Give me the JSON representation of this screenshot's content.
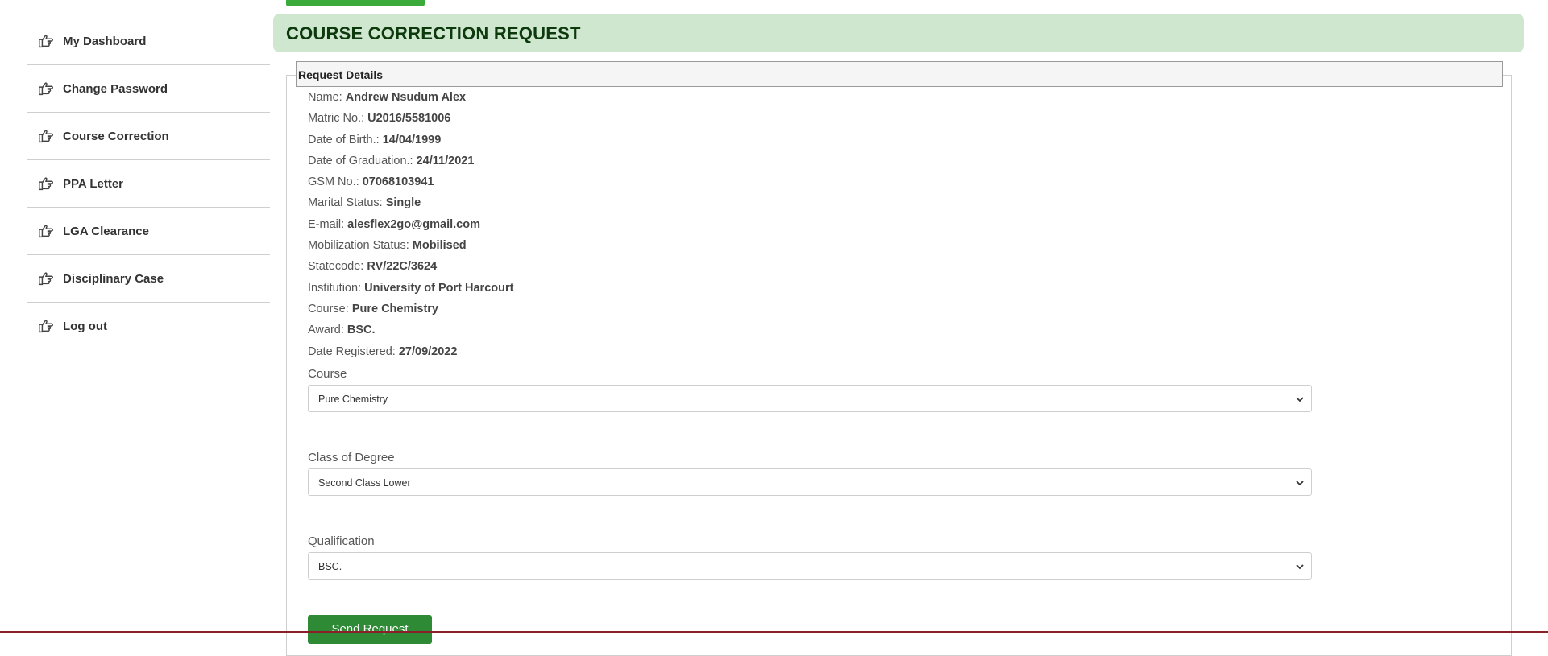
{
  "sidebar": {
    "items": [
      {
        "label": "My Dashboard"
      },
      {
        "label": "Change Password"
      },
      {
        "label": "Course Correction"
      },
      {
        "label": "PPA Letter"
      },
      {
        "label": "LGA Clearance"
      },
      {
        "label": "Disciplinary Case"
      },
      {
        "label": "Log out"
      }
    ]
  },
  "page": {
    "title": "COURSE CORRECTION REQUEST",
    "section_title": "Request Details"
  },
  "details": [
    {
      "label": "Name:",
      "value": "Andrew Nsudum Alex"
    },
    {
      "label": "Matric No.:",
      "value": "U2016/5581006"
    },
    {
      "label": "Date of Birth.:",
      "value": "14/04/1999"
    },
    {
      "label": "Date of Graduation.:",
      "value": "24/11/2021"
    },
    {
      "label": "GSM No.:",
      "value": "07068103941"
    },
    {
      "label": "Marital Status:",
      "value": "Single"
    },
    {
      "label": "E-mail:",
      "value": "alesflex2go@gmail.com"
    },
    {
      "label": "Mobilization Status:",
      "value": "Mobilised"
    },
    {
      "label": "Statecode:",
      "value": "RV/22C/3624"
    },
    {
      "label": "Institution:",
      "value": "University of Port Harcourt"
    },
    {
      "label": "Course:",
      "value": "Pure Chemistry"
    },
    {
      "label": "Award:",
      "value": "BSC."
    },
    {
      "label": "Date Registered:",
      "value": "27/09/2022"
    }
  ],
  "form": {
    "course": {
      "label": "Course",
      "selected": "Pure Chemistry"
    },
    "class_of_degree": {
      "label": "Class of Degree",
      "selected": "Second Class Lower"
    },
    "qualification": {
      "label": "Qualification",
      "selected": "BSC."
    },
    "submit_label": "Send Request"
  },
  "colors": {
    "title_bar_bg": "#cfe6cf",
    "title_text": "#0d3a0d",
    "button_green": "#2f8a35",
    "bottom_bar": "#8a1f2a"
  },
  "icons": {
    "sidebar_item": "hand-pointing-right-icon",
    "select_arrow": "chevron-down-icon"
  }
}
